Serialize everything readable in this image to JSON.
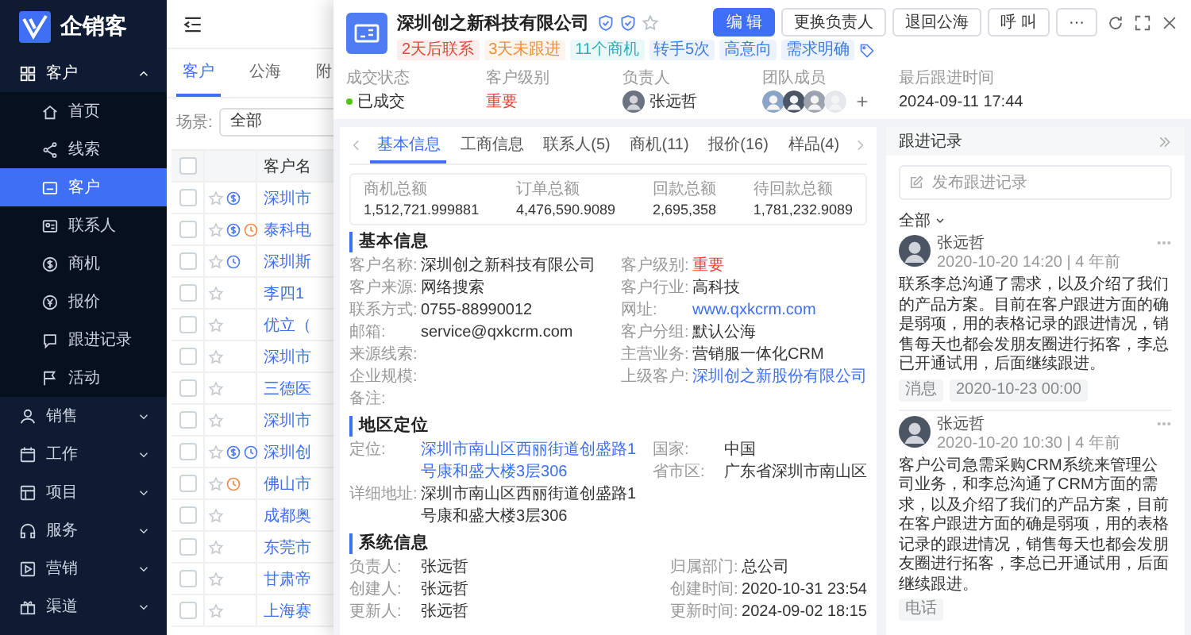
{
  "app": {
    "name": "企销客"
  },
  "sidebar": {
    "items": [
      {
        "label": "客户",
        "expanded": true,
        "children": [
          {
            "label": "首页",
            "selected": false
          },
          {
            "label": "线索",
            "selected": false
          },
          {
            "label": "客户",
            "selected": true
          },
          {
            "label": "联系人",
            "selected": false
          },
          {
            "label": "商机",
            "selected": false
          },
          {
            "label": "报价",
            "selected": false
          },
          {
            "label": "跟进记录",
            "selected": false
          },
          {
            "label": "活动",
            "selected": false
          }
        ]
      },
      {
        "label": "销售",
        "expanded": false
      },
      {
        "label": "工作",
        "expanded": false
      },
      {
        "label": "项目",
        "expanded": false
      },
      {
        "label": "服务",
        "expanded": false
      },
      {
        "label": "营销",
        "expanded": false
      },
      {
        "label": "渠道",
        "expanded": false
      }
    ]
  },
  "list": {
    "tabs": [
      {
        "label": "客户",
        "selected": true
      },
      {
        "label": "公海",
        "selected": false
      },
      {
        "label": "附",
        "selected": false
      }
    ],
    "scene": {
      "label": "场景:",
      "value": "全部"
    },
    "all_checked": false,
    "columns": [
      "客户名"
    ],
    "rows": [
      {
        "name": "深圳市",
        "checked": false,
        "badges": [
          {
            "kind": "money",
            "color": "#4e7cf2"
          }
        ]
      },
      {
        "name": "泰科电",
        "checked": false,
        "badges": [
          {
            "kind": "money",
            "color": "#4e7cf2"
          },
          {
            "kind": "clock",
            "color": "#f08a4b"
          }
        ]
      },
      {
        "name": "深圳斯",
        "checked": false,
        "badges": [
          {
            "kind": "clock",
            "color": "#4e7cf2"
          }
        ]
      },
      {
        "name": "李四1",
        "checked": false,
        "badges": []
      },
      {
        "name": "优立（",
        "checked": false,
        "badges": []
      },
      {
        "name": "深圳市",
        "checked": false,
        "badges": []
      },
      {
        "name": "三德医",
        "checked": false,
        "badges": []
      },
      {
        "name": "深圳市",
        "checked": false,
        "badges": []
      },
      {
        "name": "深圳创",
        "checked": false,
        "badges": [
          {
            "kind": "money",
            "color": "#4e7cf2"
          },
          {
            "kind": "clock",
            "color": "#4e7cf2"
          }
        ]
      },
      {
        "name": "佛山市",
        "checked": false,
        "badges": [
          {
            "kind": "clock",
            "color": "#f08a4b"
          }
        ]
      },
      {
        "name": "成都奥",
        "checked": false,
        "badges": []
      },
      {
        "name": "东莞市",
        "checked": false,
        "badges": []
      },
      {
        "name": "甘肃帝",
        "checked": false,
        "badges": []
      },
      {
        "name": "上海赛",
        "checked": false,
        "badges": []
      }
    ]
  },
  "customer": {
    "title": "深圳创之新科技有限公司",
    "tags": [
      {
        "text": "2天后联系",
        "color": "#e8453c"
      },
      {
        "text": "3天未跟进",
        "color": "#e8913c"
      },
      {
        "text": "11个商机",
        "color": "#2ab0b8"
      },
      {
        "text": "转手5次",
        "color": "#3d7be0"
      },
      {
        "text": "高意向",
        "color": "#3d7be0"
      },
      {
        "text": "需求明确",
        "color": "#3d7be0"
      }
    ],
    "buttons": [
      {
        "label": "编 辑",
        "primary": true
      },
      {
        "label": "更换负责人",
        "primary": false
      },
      {
        "label": "退回公海",
        "primary": false
      },
      {
        "label": "呼 叫",
        "primary": false
      },
      {
        "label": "···",
        "primary": false
      }
    ],
    "stats": [
      {
        "kind": "status",
        "label": "成交状态",
        "value": "已成交",
        "color": "#52c41a"
      },
      {
        "kind": "danger",
        "label": "客户级别",
        "value": "重要"
      },
      {
        "kind": "user",
        "label": "负责人",
        "value": "张远哲"
      },
      {
        "kind": "team",
        "label": "团队成员"
      },
      {
        "kind": "text",
        "label": "最后跟进时间",
        "value": "2024-09-11 17:44"
      }
    ]
  },
  "detail": {
    "tabs": [
      {
        "label": "基本信息",
        "selected": true
      },
      {
        "label": "工商信息",
        "selected": false
      },
      {
        "label": "联系人(5)",
        "selected": false
      },
      {
        "label": "商机(11)",
        "selected": false
      },
      {
        "label": "报价(16)",
        "selected": false
      },
      {
        "label": "样品(4)",
        "selected": false
      }
    ],
    "summary": [
      {
        "label": "商机总额",
        "value": "1,512,721.999881"
      },
      {
        "label": "订单总额",
        "value": "4,476,590.9089"
      },
      {
        "label": "回款总额",
        "value": "2,695,358"
      },
      {
        "label": "待回款总额",
        "value": "1,781,232.9089"
      }
    ],
    "sections": [
      {
        "title": "基本信息",
        "left": [
          {
            "label": "客户名称:",
            "value": "深圳创之新科技有限公司"
          },
          {
            "label": "客户来源:",
            "value": "网络搜索"
          },
          {
            "label": "联系方式:",
            "value": "0755-88990012"
          },
          {
            "label": "邮箱:",
            "value": "service@qxkcrm.com"
          },
          {
            "label": "来源线索:"
          },
          {
            "label": "企业规模:"
          },
          {
            "label": "备注:"
          }
        ],
        "right": [
          {
            "label": "客户级别:",
            "value": "重要",
            "kind": "danger"
          },
          {
            "label": "客户行业:",
            "value": "高科技"
          },
          {
            "label": "网址:",
            "value": "www.qxkcrm.com",
            "kind": "link"
          },
          {
            "label": "客户分组:",
            "value": "默认公海"
          },
          {
            "label": "主营业务:",
            "value": "营销服一体化CRM"
          },
          {
            "label": "上级客户:",
            "value": "深圳创之新股份有限公司",
            "kind": "link"
          }
        ]
      },
      {
        "title": "地区定位",
        "left": [
          {
            "label": "定位:",
            "value": "深圳市南山区西丽街道创盛路1号康和盛大楼3层306",
            "kind": "link"
          },
          {
            "label": "详细地址:",
            "value": "深圳市南山区西丽街道创盛路1号康和盛大楼3层306"
          }
        ],
        "right": [
          {
            "label": "国家:",
            "value": "中国"
          },
          {
            "label": "省市区:",
            "value": "广东省深圳市南山区"
          }
        ]
      },
      {
        "title": "系统信息",
        "left": [
          {
            "label": "负责人:",
            "value": "张远哲"
          },
          {
            "label": "创建人:",
            "value": "张远哲"
          },
          {
            "label": "更新人:",
            "value": "张远哲"
          }
        ],
        "right": [
          {
            "label": "归属部门:",
            "value": "总公司"
          },
          {
            "label": "创建时间:",
            "value": "2020-10-31 23:54"
          },
          {
            "label": "更新时间:",
            "value": "2024-09-02 18:15"
          }
        ]
      }
    ]
  },
  "followup": {
    "title": "跟进记录",
    "placeholder": "发布跟进记录",
    "filter": "全部",
    "records": [
      {
        "author": "张远哲",
        "time": "2020-10-20 14:20 | 4 年前",
        "content": "联系李总沟通了需求，以及介绍了我们的产品方案。目前在客户跟进方面的确是弱项，用的表格记录的跟进情况，销售每天也都会发朋友圈进行拓客，李总已开通试用，后面继续跟进。",
        "tags": [
          "消息",
          "2020-10-23 00:00"
        ]
      },
      {
        "author": "张远哲",
        "time": "2020-10-20 10:30 | 4 年前",
        "content": "客户公司急需采购CRM系统来管理公司业务，和李总沟通了CRM方面的需求，以及介绍了我们的产品方案，目前在客户跟进方面的确是弱项，用的表格记录的跟进情况，销售每天也都会发朋友圈进行拓客，李总已开通试用，后面继续跟进。",
        "tags": [
          "电话"
        ]
      }
    ]
  }
}
